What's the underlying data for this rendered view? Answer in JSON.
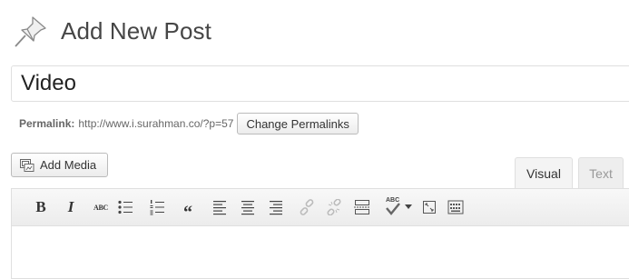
{
  "header": {
    "title": "Add New Post",
    "icon": "pushpin-icon"
  },
  "post_title": {
    "value": "Video"
  },
  "permalink": {
    "label": "Permalink:",
    "url": "http://www.i.surahman.co/?p=57",
    "button_label": "Change Permalinks"
  },
  "media": {
    "button_label": "Add Media",
    "icon": "media-icon"
  },
  "editor_tabs": [
    {
      "label": "Visual",
      "active": true
    },
    {
      "label": "Text",
      "active": false
    }
  ],
  "toolbar": {
    "bold_label": "B",
    "italic_label": "I",
    "strikethrough_label": "ABC",
    "spellcheck_label": "ABC",
    "blockquote_label": "“",
    "items": [
      "bold-icon",
      "italic-icon",
      "strikethrough-icon",
      "bullet-list-icon",
      "numbered-list-icon",
      "blockquote-icon",
      "align-left-icon",
      "align-center-icon",
      "align-right-icon",
      "insert-link-icon",
      "remove-link-icon",
      "read-more-icon",
      "spellcheck-icon",
      "dropdown-arrow-icon",
      "fullscreen-icon",
      "kitchen-sink-icon"
    ]
  },
  "colors": {
    "title_text": "#464646",
    "border": "#dfdfdf",
    "toolbar_bg": "#f1f1f1",
    "disabled_icon": "#bbbbbb"
  }
}
